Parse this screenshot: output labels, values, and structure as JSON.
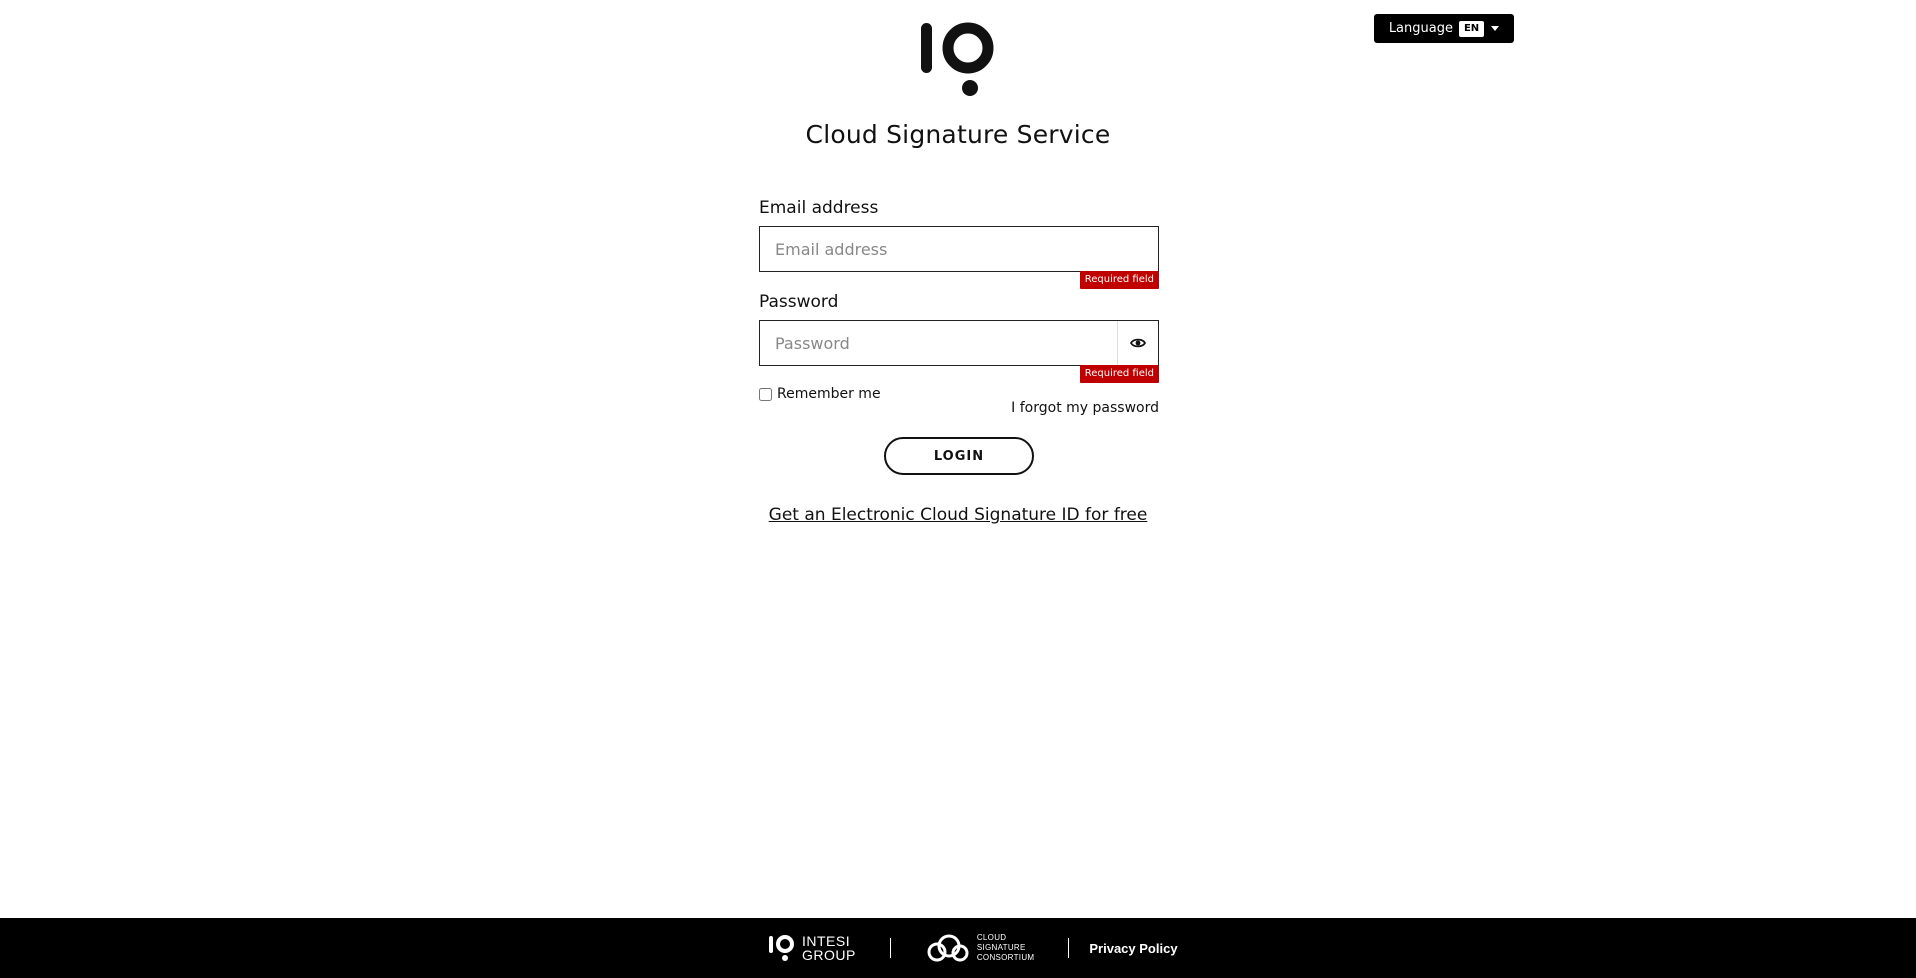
{
  "header": {
    "language_label": "Language",
    "language_code": "EN",
    "logo_icon": "io-logo-icon"
  },
  "title": "Cloud Signature Service",
  "form": {
    "email": {
      "label": "Email address",
      "placeholder": "Email address",
      "value": "",
      "error": "Required field"
    },
    "password": {
      "label": "Password",
      "placeholder": "Password",
      "value": "",
      "error": "Required field",
      "toggle_icon": "eye-icon"
    },
    "remember_label": "Remember me",
    "remember_checked": false,
    "forgot_label": "I forgot my password",
    "login_label": "LOGIN"
  },
  "get_id_link": "Get an Electronic Cloud Signature ID for free",
  "footer": {
    "intesi_line1": "INTESI",
    "intesi_line2": "GROUP",
    "csc_line1": "CLOUD",
    "csc_line2": "SIGNATURE",
    "csc_line3": "CONSORTIUM",
    "privacy_label": "Privacy Policy"
  },
  "colors": {
    "error": "#c00000",
    "footer_bg": "#000000",
    "text": "#111111"
  }
}
